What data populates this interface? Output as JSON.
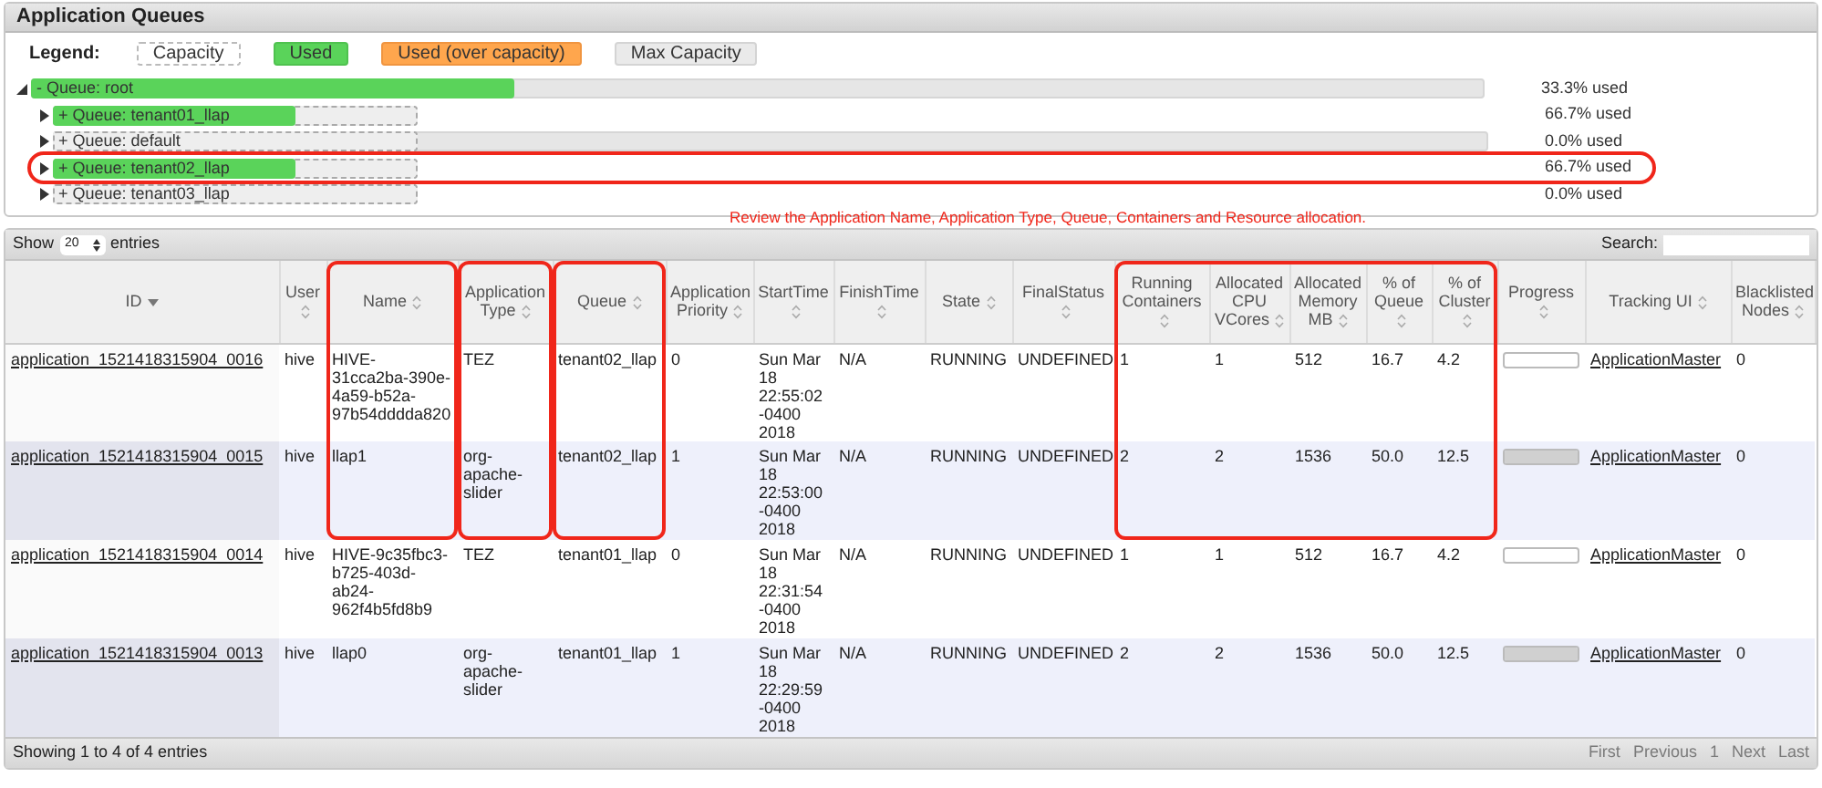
{
  "panel": {
    "title": "Application Queues"
  },
  "legend": {
    "label": "Legend:",
    "items": [
      {
        "kind": "capacity",
        "label": "Capacity"
      },
      {
        "kind": "used",
        "label": "Used"
      },
      {
        "kind": "over",
        "label": "Used (over capacity)"
      },
      {
        "kind": "max",
        "label": "Max Capacity"
      }
    ]
  },
  "queues": [
    {
      "toggle": "-",
      "label": "Queue: root",
      "level": 0.333,
      "reading": "33.3% used",
      "expanded": true,
      "max_capacity_bar": true,
      "highlighted": false,
      "children": [
        {
          "toggle": "+",
          "label": "Queue: tenant01_llap",
          "level": 0.667,
          "reading": "66.7% used",
          "expanded": false,
          "max_capacity_bar": false,
          "highlighted": false
        },
        {
          "toggle": "+",
          "label": "Queue: default",
          "reading": "0.0% used",
          "expanded": false,
          "max_capacity_bar": true,
          "highlighted": false
        },
        {
          "toggle": "+",
          "label": "Queue: tenant02_llap",
          "level": 0.667,
          "reading": "66.7% used",
          "expanded": false,
          "max_capacity_bar": false,
          "highlighted": true
        },
        {
          "toggle": "+",
          "label": "Queue: tenant03_llap",
          "reading": "0.0% used",
          "expanded": false,
          "max_capacity_bar": false,
          "highlighted": false
        }
      ]
    }
  ],
  "annotation_note": "Review the Application Name, Application Type, Queue, Containers and Resource allocation.",
  "table": {
    "show_label": "Show",
    "page_size": "20",
    "entries_label": "entries",
    "search_label": "Search:",
    "column_groups": [
      {
        "highlighted": false,
        "columns": [
          {
            "label": "ID",
            "sorted": true
          },
          {
            "label": "User",
            "sorted": false
          }
        ]
      },
      {
        "highlighted": true,
        "columns": [
          {
            "label": "Name",
            "sorted": false
          }
        ]
      },
      {
        "highlighted": true,
        "columns": [
          {
            "label": "Application Type",
            "sorted": false
          }
        ]
      },
      {
        "highlighted": true,
        "columns": [
          {
            "label": "Queue",
            "sorted": false
          }
        ]
      },
      {
        "highlighted": false,
        "columns": [
          {
            "label": "Application Priority",
            "sorted": false
          },
          {
            "label": "StartTime",
            "sorted": false
          },
          {
            "label": "FinishTime",
            "sorted": false
          },
          {
            "label": "State",
            "sorted": false
          },
          {
            "label": "FinalStatus",
            "sorted": false
          }
        ]
      },
      {
        "highlighted": true,
        "columns": [
          {
            "label": "Running Containers",
            "sorted": false
          },
          {
            "label": "Allocated CPU VCores",
            "sorted": false
          },
          {
            "label": "Allocated Memory MB",
            "sorted": false
          },
          {
            "label": "% of Queue",
            "sorted": false
          },
          {
            "label": "% of Cluster",
            "sorted": false
          }
        ]
      },
      {
        "highlighted": false,
        "columns": [
          {
            "label": "Progress",
            "sorted": false
          },
          {
            "label": "Tracking UI",
            "sorted": false
          },
          {
            "label": "Blacklisted Nodes",
            "sorted": false
          }
        ]
      }
    ],
    "rows": [
      {
        "id": "application_1521418315904_0016",
        "user": "hive",
        "name": "HIVE-31cca2ba-390e-4a59-b52a-97b54dddda820",
        "type": "TEZ",
        "queue": "tenant02_llap",
        "priority": "0",
        "start": "Sun Mar 18 22:55:02 -0400 2018",
        "finish": "N/A",
        "state": "RUNNING",
        "final_status": "UNDEFINED",
        "containers": "1",
        "vcores": "1",
        "memory": "512",
        "pct_queue": "16.7",
        "pct_cluster": "4.2",
        "tracking": "ApplicationMaster",
        "blacklisted": "0"
      },
      {
        "id": "application_1521418315904_0015",
        "user": "hive",
        "name": "llap1",
        "type": "org-apache-slider",
        "queue": "tenant02_llap",
        "priority": "1",
        "start": "Sun Mar 18 22:53:00 -0400 2018",
        "finish": "N/A",
        "state": "RUNNING",
        "final_status": "UNDEFINED",
        "containers": "2",
        "vcores": "2",
        "memory": "1536",
        "pct_queue": "50.0",
        "pct_cluster": "12.5",
        "level": 1,
        "tracking": "ApplicationMaster",
        "blacklisted": "0"
      },
      {
        "id": "application_1521418315904_0014",
        "user": "hive",
        "name": "HIVE-9c35fbc3-b725-403d-ab24-962f4b5fd8b9",
        "type": "TEZ",
        "queue": "tenant01_llap",
        "priority": "0",
        "start": "Sun Mar 18 22:31:54 -0400 2018",
        "finish": "N/A",
        "state": "RUNNING",
        "final_status": "UNDEFINED",
        "containers": "1",
        "vcores": "1",
        "memory": "512",
        "pct_queue": "16.7",
        "pct_cluster": "4.2",
        "tracking": "ApplicationMaster",
        "blacklisted": "0"
      },
      {
        "id": "application_1521418315904_0013",
        "user": "hive",
        "name": "llap0",
        "type": "org-apache-slider",
        "queue": "tenant01_llap",
        "priority": "1",
        "start": "Sun Mar 18 22:29:59 -0400 2018",
        "finish": "N/A",
        "state": "RUNNING",
        "final_status": "UNDEFINED",
        "containers": "2",
        "vcores": "2",
        "memory": "1536",
        "pct_queue": "50.0",
        "pct_cluster": "12.5",
        "level": 1,
        "tracking": "ApplicationMaster",
        "blacklisted": "0"
      }
    ],
    "info": "Showing 1 to 4 of 4 entries",
    "pager": [
      {
        "label": "First",
        "disabled": true
      },
      {
        "label": "Previous",
        "disabled": true
      },
      {
        "label": "1",
        "disabled": true
      },
      {
        "label": "Next",
        "disabled": true
      },
      {
        "label": "Last",
        "disabled": true
      }
    ]
  }
}
